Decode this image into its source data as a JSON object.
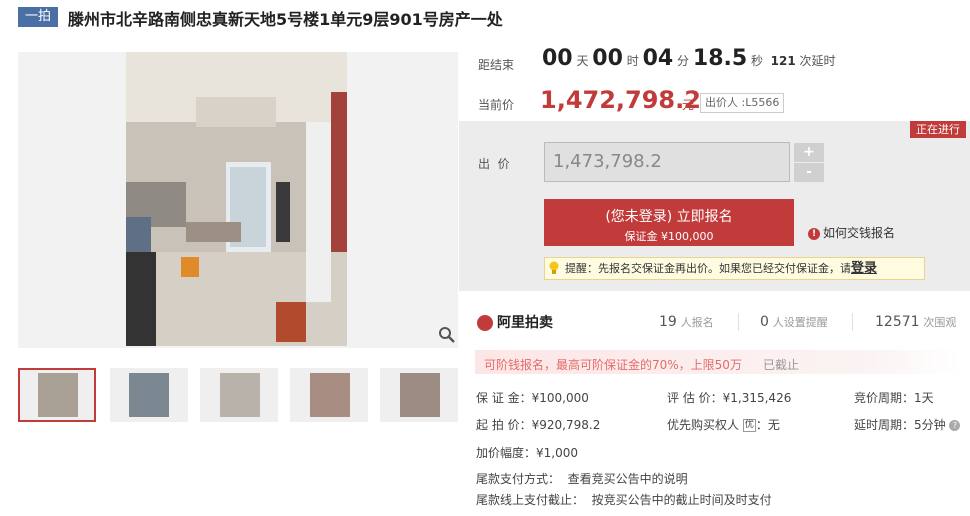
{
  "header": {
    "badge": "一拍",
    "title": "滕州市北辛路南侧忠真新天地5号楼1单元9层901号房产一处"
  },
  "countdown": {
    "label": "距结束",
    "days": "00",
    "days_unit": "天",
    "hours": "00",
    "hours_unit": "时",
    "minutes": "04",
    "minutes_unit": "分",
    "seconds": "18.5",
    "seconds_unit": "秒",
    "extensions": "121",
    "extensions_unit": "次延时"
  },
  "current_price": {
    "label": "当前价",
    "value": "1,472,798.2",
    "unit": "元",
    "bidder": "出价人 :L5566"
  },
  "status_tag": "正在进行",
  "bid": {
    "label": "出  价",
    "value": "1,473,798.2",
    "plus": "+",
    "minus": "-",
    "register_line1": "(您未登录) 立即报名",
    "register_line2": "保证金 ¥100,000",
    "how_to_pay": "如何交钱报名",
    "tip_text": "提醒：先报名交保证金再出价。如果您已经交付保证金，请",
    "tip_login": "登录"
  },
  "stats": {
    "brand": "阿里拍卖",
    "signups": "19",
    "signups_unit": "人报名",
    "reminders": "0",
    "reminders_unit": "人设置提醒",
    "views": "12571",
    "views_unit": "次围观"
  },
  "loan_notice": {
    "text": "可阶钱报名，最高可阶保证金的70%，上限50万",
    "status": "已截止"
  },
  "info": {
    "deposit": "保 证 金：¥100,000",
    "start_price": "起 拍 价：¥920,798.2",
    "increment": "加价幅度：¥1,000",
    "appraisal": "评 估 价：¥1,315,426",
    "priority": "优先购买权人",
    "priority_badge": "优",
    "priority_value": "：无",
    "period": "竞价周期：1天",
    "delay": "延时周期：5分钟",
    "balance_method": "尾款支付方式：  查看竞买公告中的说明",
    "balance_deadline": "尾款线上支付截止：  按竞买公告中的截止时间及时支付"
  }
}
